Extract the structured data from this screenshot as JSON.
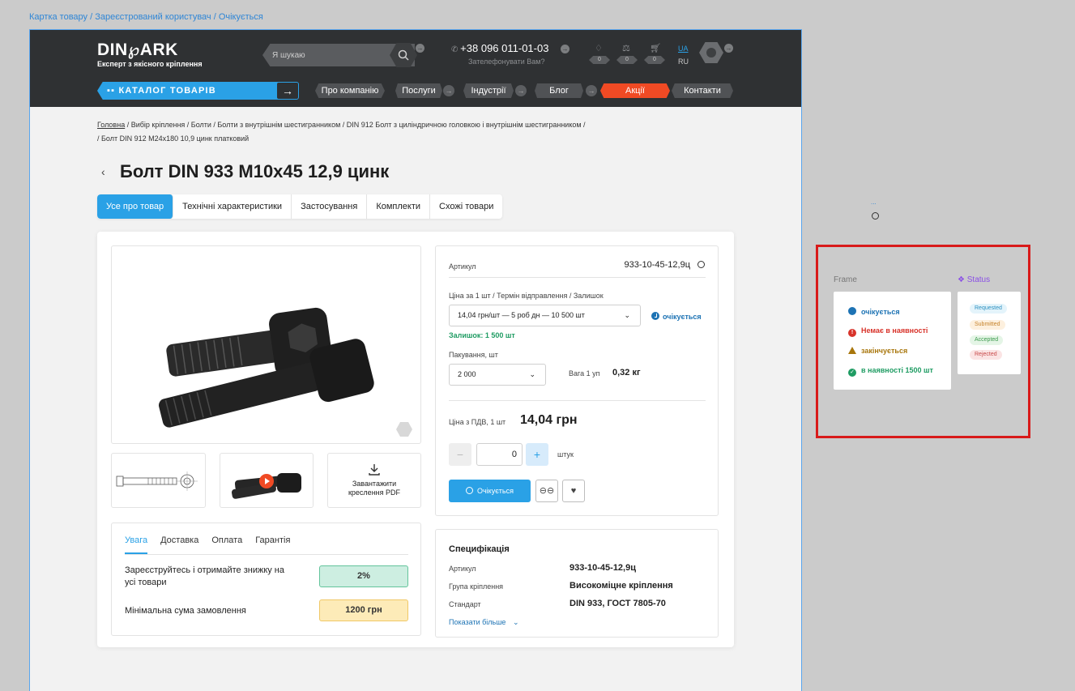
{
  "frame_caption": "Картка товару / Зареєстрований користувач / Очікується",
  "header": {
    "logo_word": "DIN℘ARK",
    "logo_sub": "Експерт з якісного кріплення",
    "search_placeholder": "Я шукаю",
    "phone": "+38 096 011-01-03",
    "phone_sub": "Зателефонувати Вам?",
    "counters": [
      "0",
      "0",
      "0"
    ],
    "lang_active": "UA",
    "lang_other": "RU",
    "catalog_label": "КАТАЛОГ ТОВАРІВ",
    "nav": [
      "Про компанію",
      "Послуги",
      "Індустрії",
      "Блог",
      "Акції",
      "Контакти"
    ]
  },
  "breadcrumbs": {
    "home": "Головна",
    "rest": " / Вибір кріплення / Болти / Болти з внутрішнім шестигранником / DIN 912 Болт з циліндричною головкою і внутрішнім шестигранником /",
    "line2": "/ Болт DIN 912 M24x180 10,9 цинк платковий"
  },
  "product": {
    "back": "‹",
    "title": "Болт DIN 933 M10x45 12,9 цинк",
    "tabs": [
      "Усе про товар",
      "Технічні характеристики",
      "Застосування",
      "Комплекти",
      "Схожі товари"
    ],
    "download_label": "Завантажити креслення PDF",
    "info_tabs": [
      "Увага",
      "Доставка",
      "Оплата",
      "Гарантія"
    ],
    "promo_text": "Зареєструйтесь і отримайте знижку на усі товари",
    "promo_value": "2%",
    "min_order_text": "Мінімальна сума замовлення",
    "min_order_value": "1200 грн"
  },
  "buy": {
    "sku_label": "Артикул",
    "sku_value": "933-10-45-12,9ц",
    "price_label": "Ціна за 1 шт / Термін відправлення / Залишок",
    "price_select": "14,04 грн/шт — 5 роб дн — 10 500 шт",
    "stock_status": "очікується",
    "remainder": "Залишок:  1 500 шт",
    "pack_label": "Пакування, шт",
    "pack_select": "2 000",
    "weight_label": "Вага 1 уп",
    "weight_value": "0,32 кг",
    "vat_label": "Ціна з ПДВ, 1 шт",
    "vat_price": "14,04 грн",
    "qty": "0",
    "unit": "штук",
    "minus": "−",
    "plus": "+",
    "cta_label": "Очікується"
  },
  "spec": {
    "title": "Специфікація",
    "rows": [
      {
        "k": "Артикул",
        "v": "933-10-45-12,9ц"
      },
      {
        "k": "Група кріплення",
        "v": "Високоміцне кріплення"
      },
      {
        "k": "Стандарт",
        "v": "DIN 933, ГОСТ 7805-70"
      }
    ],
    "more": "Показати більше"
  },
  "right_panel": {
    "dots": "...",
    "frame_label": "Frame",
    "status_label": "❖ Status",
    "statuses": [
      {
        "text": "очікується",
        "color": "#1d73b4"
      },
      {
        "text": "Немає в наявності",
        "color": "#d8332a"
      },
      {
        "text": "закінчується",
        "color": "#a8760c"
      },
      {
        "text": "в наявності 1500 шт",
        "color": "#1f9c63"
      }
    ],
    "chips": [
      "Requested",
      "Submitted",
      "Accepted",
      "Rejected"
    ]
  },
  "colors": {
    "accent": "#2aa1e6",
    "header_bg": "#2f3133",
    "promo_red": "#f04a24",
    "highlight_frame": "#d81a1a"
  }
}
